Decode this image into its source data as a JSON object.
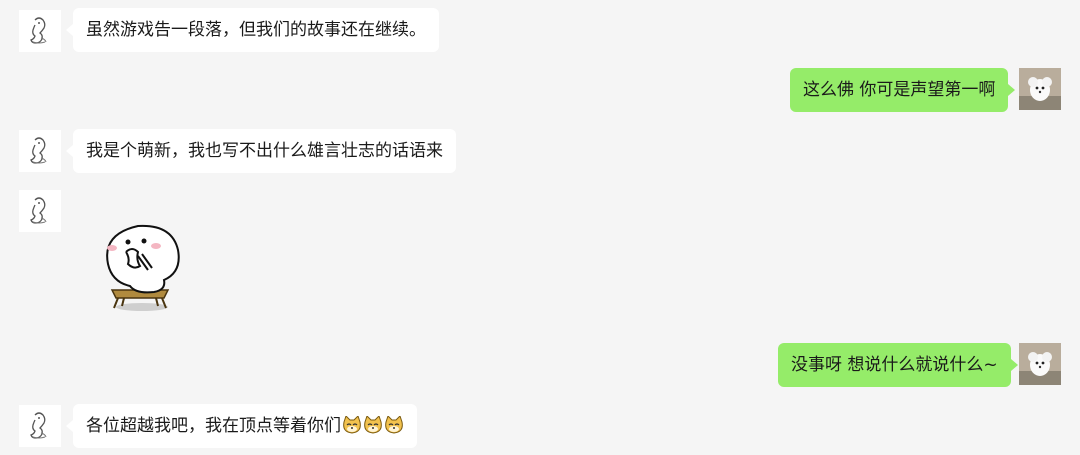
{
  "messages": [
    {
      "side": "in",
      "avatar": "sketch-figure-avatar",
      "text": "虽然游戏告一段落，但我们的故事还在继续。"
    },
    {
      "side": "out",
      "avatar": "white-dog-avatar",
      "text": "这么佛 你可是声望第一啊"
    },
    {
      "side": "in",
      "avatar": "sketch-figure-avatar",
      "text": "我是个萌新，我也写不出什么雄言壮志的话语来"
    },
    {
      "side": "in",
      "avatar": "sketch-figure-avatar",
      "sticker": "thinking-blob-sticker"
    },
    {
      "side": "out",
      "avatar": "white-dog-avatar",
      "text": "没事呀 想说什么就说什么~"
    },
    {
      "side": "in",
      "avatar": "sketch-figure-avatar",
      "text": "各位超越我吧，我在顶点等着你们",
      "emojis": [
        "doge-emoji",
        "doge-emoji",
        "doge-emoji"
      ]
    }
  ],
  "colors": {
    "background": "#f5f5f5",
    "incoming_bubble": "#ffffff",
    "outgoing_bubble": "#95ec69"
  }
}
